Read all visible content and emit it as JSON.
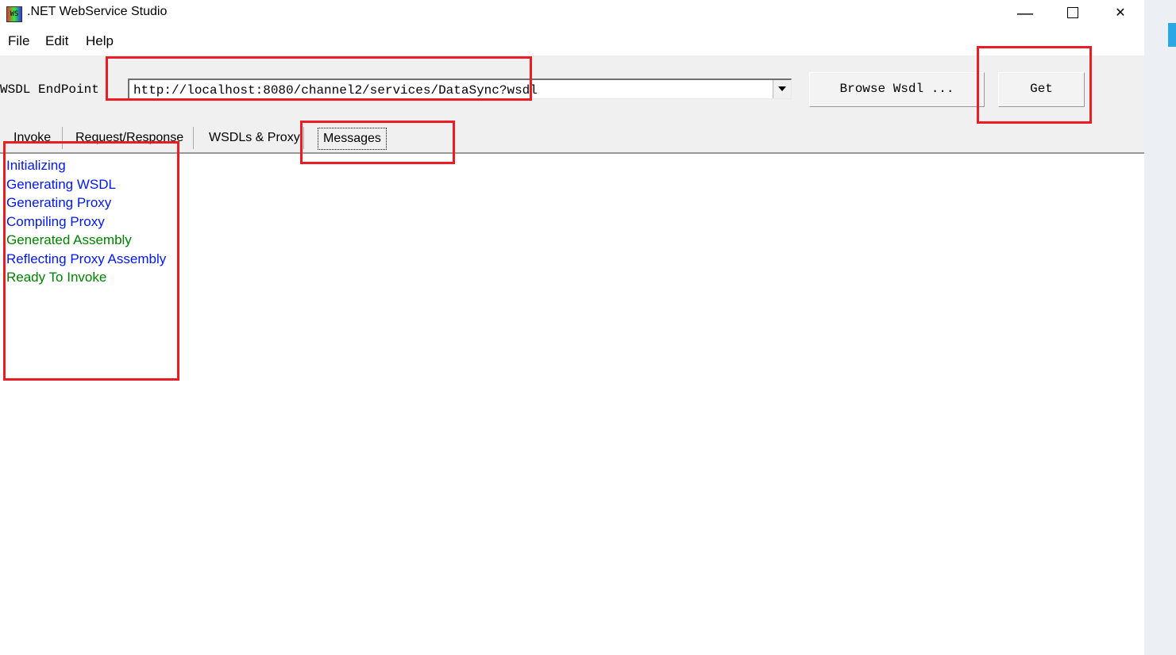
{
  "window": {
    "title": ".NET WebService Studio",
    "icon_label": "WS"
  },
  "menu": {
    "file": "File",
    "edit": "Edit",
    "help": "Help"
  },
  "toolbar": {
    "endpoint_label": "WSDL EndPoint",
    "endpoint_value": "http://localhost:8080/channel2/services/DataSync?wsdl",
    "browse_label": "Browse Wsdl ...",
    "get_label": "Get"
  },
  "tabs": {
    "invoke": "Invoke",
    "reqresp": "Request/Response",
    "wsdls": "WSDLs & Proxy",
    "messages": "Messages",
    "active": "messages"
  },
  "messages": [
    {
      "text": "Initializing",
      "color": "blue"
    },
    {
      "text": "Generating WSDL",
      "color": "blue"
    },
    {
      "text": "Generating Proxy",
      "color": "blue"
    },
    {
      "text": "Compiling Proxy",
      "color": "blue"
    },
    {
      "text": "Generated Assembly",
      "color": "green"
    },
    {
      "text": "Reflecting Proxy Assembly",
      "color": "blue"
    },
    {
      "text": "Ready To Invoke",
      "color": "green"
    }
  ],
  "annotations": {
    "highlight_color": "#ec1c24"
  }
}
